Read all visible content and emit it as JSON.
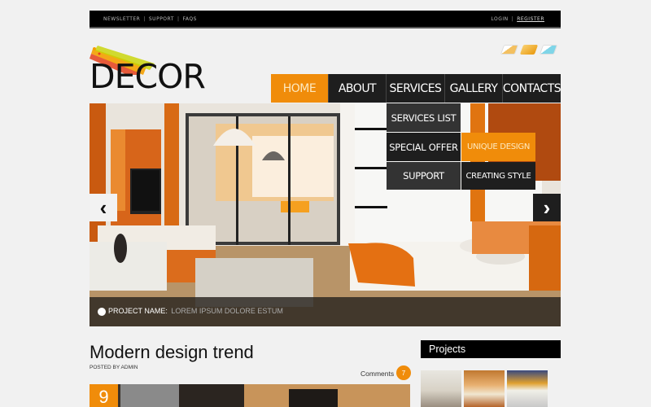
{
  "topbar": {
    "links_left": [
      "NEWSLETTER",
      "SUPPORT",
      "FAQS"
    ],
    "login": "LOGIN",
    "register": "REGISTER"
  },
  "logo": {
    "text": "DECOR"
  },
  "social": [
    "rss-icon",
    "mail-icon",
    "twitter-icon"
  ],
  "nav": {
    "items": [
      {
        "label": "HOME",
        "active": true
      },
      {
        "label": "ABOUT",
        "active": false
      },
      {
        "label": "SERVICES",
        "active": false
      },
      {
        "label": "GALLERY",
        "active": false
      },
      {
        "label": "CONTACTS",
        "active": false
      }
    ]
  },
  "dropdown": {
    "items": [
      "SERVICES LIST",
      "SPECIAL OFFER",
      "SUPPORT"
    ],
    "submenu": [
      "UNIQUE DESIGN",
      "CREATING STYLE"
    ]
  },
  "slider": {
    "caption_label": "PROJECT NAME:",
    "caption_value": "LOREM IPSUM DOLORE ESTUM",
    "prev_icon": "‹",
    "next_icon": "›"
  },
  "post": {
    "title": "Modern design trend",
    "posted_by": "POSTED BY ADMIN",
    "comments_label": "Comments",
    "comments_count": "7",
    "date_day": "9"
  },
  "projects": {
    "title": "Projects"
  },
  "colors": {
    "accent": "#f08c0a",
    "dark": "#1e1e1e",
    "background": "#f1f1f1"
  }
}
